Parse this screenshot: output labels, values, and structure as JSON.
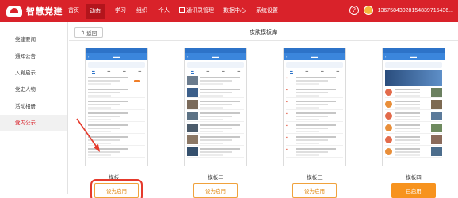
{
  "topbar": {
    "logo_text": "智慧党建",
    "nav": [
      "首页",
      "动态",
      "学习",
      "组织",
      "个人",
      "通讯录管理",
      "数据中心",
      "系统设置"
    ],
    "active_index": 1,
    "account": "13675843028154839715436..."
  },
  "sidebar": {
    "items": [
      "党建要闻",
      "通知公告",
      "入党启示",
      "党史人物",
      "活动相册",
      "党内公示"
    ],
    "active_index": 5
  },
  "main": {
    "back_label": "返回",
    "title": "皮肤模板库",
    "templates": [
      {
        "name": "模板一",
        "button": "设为启用",
        "used": false
      },
      {
        "name": "模板二",
        "button": "设为启用",
        "used": false
      },
      {
        "name": "模板三",
        "button": "设为启用",
        "used": false
      },
      {
        "name": "模板四",
        "button": "已启用",
        "used": true
      }
    ]
  },
  "colors": {
    "brand": "#d9222a",
    "accent": "#f7931e",
    "phone_header": "#3b86dc"
  }
}
